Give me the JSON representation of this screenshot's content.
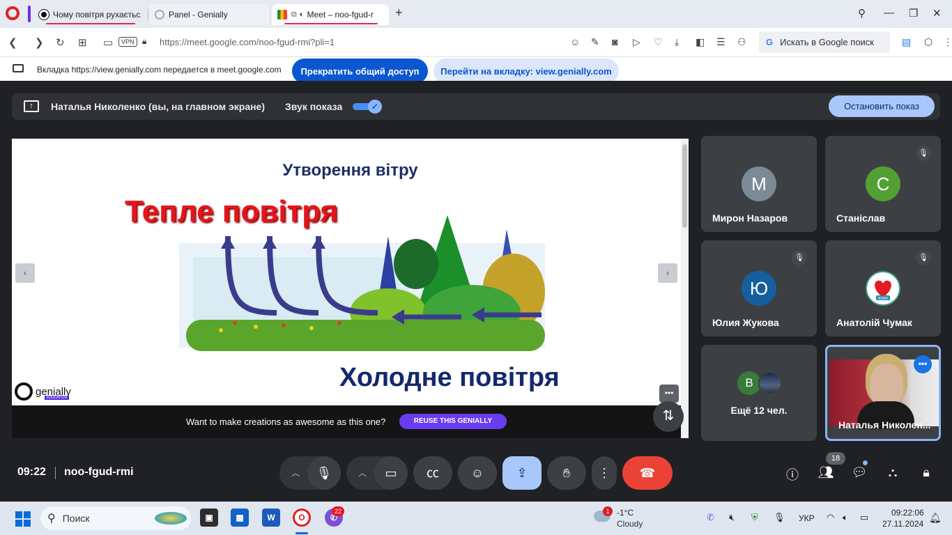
{
  "browser": {
    "tabs": [
      {
        "title": "Чому повітря рухається?"
      },
      {
        "title": "Panel - Genially"
      },
      {
        "title": "Meet – noo-fgud-r"
      }
    ],
    "url": "https://meet.google.com/noo-fgud-rmi?pli=1",
    "vpn_label": "VPN",
    "search_placeholder": "Искать в Google поиск",
    "share_notice": "Вкладка https://view.genially.com передается в meet.google.com",
    "stop_sharing_label": "Прекратить общий доступ",
    "switch_tab_label": "Перейти на вкладку: view.genially.com"
  },
  "meet": {
    "presenter_label": "Наталья Николенко (вы, на главном экране)",
    "sound_label": "Звук показа",
    "sound_enabled": true,
    "stop_presenting_label": "Остановить показ",
    "slide": {
      "title": "Утворення вітру",
      "warm_label": "Тепле повітря",
      "cold_label": "Холодне повітря",
      "logo_text": "genially",
      "logo_sub": "EDUCATION",
      "reuse_text": "Want to make creations as awesome as this one?",
      "reuse_button": "REUSE THIS GENIALLY"
    },
    "participants": [
      {
        "name": "Мирон Назаров",
        "initial": "М",
        "color": "#7a8b96",
        "muted": false
      },
      {
        "name": "Станіслав",
        "initial": "С",
        "color": "#52a034",
        "muted": true
      },
      {
        "name": "Юлия Жукова",
        "initial": "Ю",
        "color": "#155fa0",
        "muted": true
      },
      {
        "name": "Анатолій Чумак",
        "initial": "ASHR",
        "color": "#ffffff",
        "muted": true
      }
    ],
    "more": {
      "initial": "В",
      "label": "Ещё 12 чел."
    },
    "self_name": "Наталья Николен...",
    "time": "09:22",
    "meeting_code": "noo-fgud-rmi",
    "participant_count": "18"
  },
  "taskbar": {
    "search_label": "Поиск",
    "chat_badge": "22",
    "weather_badge": "1",
    "weather_temp": "-1°C",
    "weather_desc": "Cloudy",
    "language": "УКР",
    "time": "09:22:06",
    "date": "27.11.2024"
  }
}
